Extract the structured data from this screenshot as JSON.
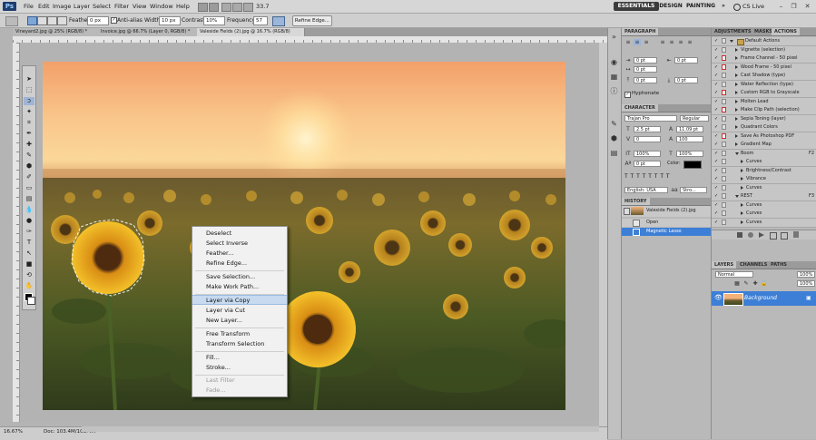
{
  "app": {
    "logo": "Ps",
    "menu": [
      "File",
      "Edit",
      "Image",
      "Layer",
      "Select",
      "Filter",
      "View",
      "Window",
      "Help"
    ],
    "zoom_value": "33.7",
    "workspaces": [
      "ESSENTIALS",
      "DESIGN",
      "PAINTING",
      "»"
    ],
    "cs_live": "CS Live",
    "window_controls": [
      "–",
      "❐",
      "✕"
    ]
  },
  "options": {
    "feather_label": "Feather:",
    "feather_value": "0 px",
    "antialias_label": "Anti-alias",
    "width_label": "Width:",
    "width_value": "10 px",
    "contrast_label": "Contrast:",
    "contrast_value": "10%",
    "frequency_label": "Frequency:",
    "frequency_value": "57",
    "refine_edge": "Refine Edge..."
  },
  "tabs": [
    "Vineyard2.jpg @ 25% (RGB/8) *",
    "Invoice.jpg @ 66.7% (Layer 0, RGB/8) *",
    "Valeside Fields (2).jpg @ 16.7% (RGB/8)"
  ],
  "context_menu": {
    "items": [
      {
        "label": "Deselect",
        "state": "normal"
      },
      {
        "label": "Select Inverse",
        "state": "normal"
      },
      {
        "label": "Feather...",
        "state": "normal"
      },
      {
        "label": "Refine Edge...",
        "state": "normal"
      },
      {
        "label": "Save Selection...",
        "state": "normal"
      },
      {
        "label": "Make Work Path...",
        "state": "normal"
      },
      {
        "label": "Layer via Copy",
        "state": "highlighted"
      },
      {
        "label": "Layer via Cut",
        "state": "normal"
      },
      {
        "label": "New Layer...",
        "state": "normal"
      },
      {
        "label": "Free Transform",
        "state": "normal"
      },
      {
        "label": "Transform Selection",
        "state": "normal"
      },
      {
        "label": "Fill...",
        "state": "normal"
      },
      {
        "label": "Stroke...",
        "state": "normal"
      },
      {
        "label": "Last Filter",
        "state": "disabled"
      },
      {
        "label": "Fade...",
        "state": "disabled"
      }
    ]
  },
  "status": {
    "zoom": "16.67%",
    "doc": "Doc: 103.4M/103.4M"
  },
  "paragraph": {
    "tab": "PARAGRAPH",
    "fields": [
      "0 pt",
      "0 pt",
      "0 pt",
      "0 pt",
      "0 pt"
    ],
    "hyphenate": "Hyphenate"
  },
  "character": {
    "tab": "CHARACTER",
    "font": "Trajan Pro",
    "style": "Regular",
    "size": "2.5 pt",
    "leading": "11.09 pt",
    "kerning": "0",
    "tracking": "100",
    "vscale": "100%",
    "hscale": "100%",
    "baseline": "0 pt",
    "color_label": "Color:",
    "language": "English: USA",
    "aa": "Stro..."
  },
  "history": {
    "tab": "HISTORY",
    "snapshot": "Valeside Fields (2).jpg",
    "items": [
      {
        "label": "Open",
        "selected": false
      },
      {
        "label": "Magnetic Lasso",
        "selected": true
      }
    ]
  },
  "actions": {
    "tabs": [
      "ADJUSTMENTS",
      "MASKS",
      "ACTIONS"
    ],
    "rows": [
      {
        "label": "Default Actions",
        "fn": "",
        "indent": 0,
        "type": "set",
        "red": false
      },
      {
        "label": "Vignette (selection)",
        "fn": "",
        "indent": 1,
        "type": "action",
        "red": false
      },
      {
        "label": "Frame Channel - 50 pixel",
        "fn": "",
        "indent": 1,
        "type": "action",
        "red": true
      },
      {
        "label": "Wood Frame - 50 pixel",
        "fn": "",
        "indent": 1,
        "type": "action",
        "red": true
      },
      {
        "label": "Cast Shadow (type)",
        "fn": "",
        "indent": 1,
        "type": "action",
        "red": false
      },
      {
        "label": "Water Reflection (type)",
        "fn": "",
        "indent": 1,
        "type": "action",
        "red": false
      },
      {
        "label": "Custom RGB to Grayscale",
        "fn": "",
        "indent": 1,
        "type": "action",
        "red": true
      },
      {
        "label": "Molten Lead",
        "fn": "",
        "indent": 1,
        "type": "action",
        "red": false
      },
      {
        "label": "Make Clip Path (selection)",
        "fn": "",
        "indent": 1,
        "type": "action",
        "red": true
      },
      {
        "label": "Sepia Toning (layer)",
        "fn": "",
        "indent": 1,
        "type": "action",
        "red": false
      },
      {
        "label": "Quadrant Colors",
        "fn": "",
        "indent": 1,
        "type": "action",
        "red": false
      },
      {
        "label": "Save As Photoshop PDF",
        "fn": "",
        "indent": 1,
        "type": "action",
        "red": true
      },
      {
        "label": "Gradient Map",
        "fn": "",
        "indent": 1,
        "type": "action",
        "red": false
      },
      {
        "label": "Boom",
        "fn": "F2",
        "indent": 1,
        "type": "open",
        "red": false
      },
      {
        "label": "Curves",
        "fn": "",
        "indent": 2,
        "type": "action",
        "red": false
      },
      {
        "label": "Brightness/Contrast",
        "fn": "",
        "indent": 2,
        "type": "action",
        "red": false
      },
      {
        "label": "Vibrance",
        "fn": "",
        "indent": 2,
        "type": "action",
        "red": false
      },
      {
        "label": "Curves",
        "fn": "",
        "indent": 2,
        "type": "action",
        "red": false
      },
      {
        "label": "REST",
        "fn": "F3",
        "indent": 1,
        "type": "open",
        "red": false
      },
      {
        "label": "Curves",
        "fn": "",
        "indent": 2,
        "type": "action",
        "red": false
      },
      {
        "label": "Curves",
        "fn": "",
        "indent": 2,
        "type": "action",
        "red": false
      },
      {
        "label": "Curves",
        "fn": "",
        "indent": 2,
        "type": "action",
        "red": false
      }
    ]
  },
  "layers": {
    "tabs": [
      "LAYERS",
      "CHANNELS",
      "PATHS"
    ],
    "blend": "Normal",
    "opacity": "100%",
    "fill": "100%",
    "layer_name": "Background"
  },
  "colors": {
    "selection": "#3d7fd6",
    "highlight": "#c7daf0"
  }
}
